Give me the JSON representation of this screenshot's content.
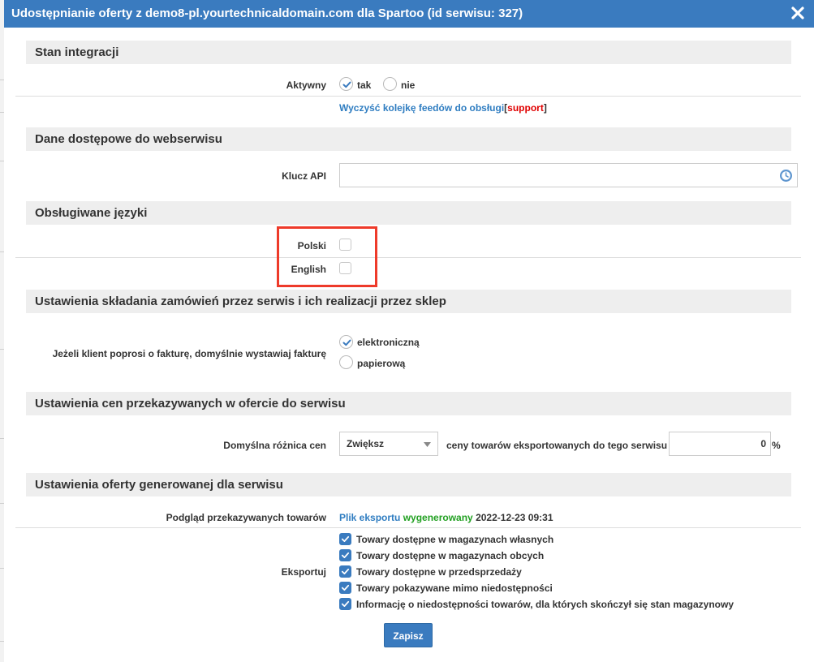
{
  "dialog": {
    "title": "Udostępnianie oferty z demo8-pl.yourtechnicaldomain.com dla Spartoo (id serwisu: 327)"
  },
  "integration": {
    "section_title": "Stan integracji",
    "active_label": "Aktywny",
    "option_yes": "tak",
    "option_no": "nie",
    "selected": "tak",
    "clear_link": "Wyczyść kolejkę feedów do obsługi",
    "bracket_open": "[",
    "support_link": "support",
    "bracket_close": "]"
  },
  "access": {
    "section_title": "Dane dostępowe do webserwisu",
    "api_key_label": "Klucz API",
    "api_key_value": ""
  },
  "languages": {
    "section_title": "Obsługiwane języki",
    "items": [
      {
        "label": "Polski",
        "checked": false
      },
      {
        "label": "English",
        "checked": false
      }
    ]
  },
  "orders": {
    "section_title": "Ustawienia składania zamówień przez serwis i ich realizacji przez sklep",
    "invoice_label": "Jeżeli klient poprosi o fakturę, domyślnie wystawiaj fakturę",
    "option_electronic": "elektroniczną",
    "option_paper": "papierową",
    "selected": "elektroniczną"
  },
  "prices": {
    "section_title": "Ustawienia cen przekazywanych w ofercie do serwisu",
    "diff_label": "Domyślna różnica cen",
    "select_value": "Zwiększ",
    "middle_text": "ceny towarów eksportowanych do tego serwisu o",
    "percent_value": "0",
    "percent_unit": "%"
  },
  "offer": {
    "section_title": "Ustawienia oferty generowanej dla serwisu",
    "preview_label": "Podgląd przekazywanych towarów",
    "file_link": "Plik eksportu",
    "status_text": "wygenerowany",
    "timestamp": "2022-12-23 09:31",
    "export_label": "Eksportuj",
    "export_items": [
      {
        "label": "Towary dostępne w magazynach własnych",
        "checked": true
      },
      {
        "label": "Towary dostępne w magazynach obcych",
        "checked": true
      },
      {
        "label": "Towary dostępne w przedsprzedaży",
        "checked": true
      },
      {
        "label": "Towary pokazywane mimo niedostępności",
        "checked": true
      },
      {
        "label": "Informację o niedostępności towarów, dla których skończył się stan magazynowy",
        "checked": true
      }
    ]
  },
  "footer": {
    "save_label": "Zapisz"
  },
  "colors": {
    "accent": "#3a7bbf",
    "highlight": "#ee3a2a",
    "support": "#e00000",
    "generated": "#22a022"
  }
}
